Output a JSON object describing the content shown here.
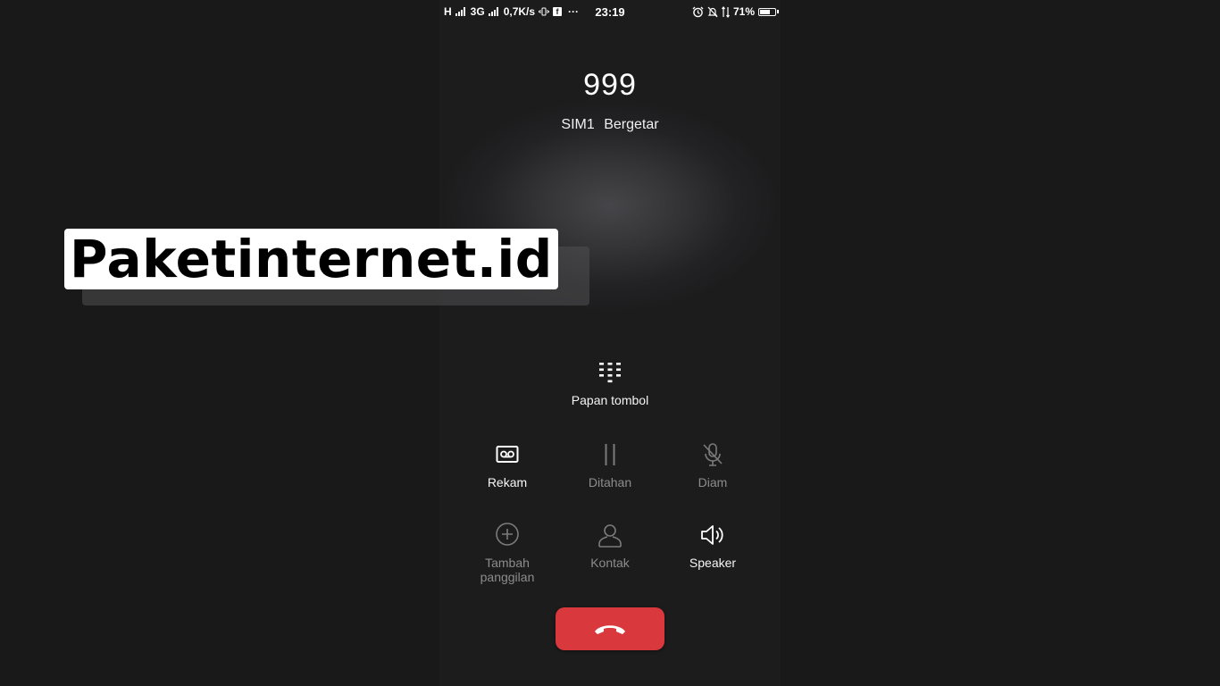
{
  "status_bar": {
    "network_1": "H",
    "network_2": "3G",
    "speed": "0,7K/s",
    "fb_icon_text": "f",
    "more": "···",
    "time": "23:19",
    "battery": "71%",
    "battery_level": 0.71
  },
  "call": {
    "number": "999",
    "sim": "SIM1",
    "mode": "Bergetar"
  },
  "keypad": {
    "label": "Papan tombol"
  },
  "actions": [
    {
      "label": "Rekam",
      "icon": "record-icon",
      "enabled": true
    },
    {
      "label": "Ditahan",
      "icon": "pause-icon",
      "enabled": false
    },
    {
      "label": "Diam",
      "icon": "mic-off-icon",
      "enabled": false
    },
    {
      "label": "Tambah panggilan",
      "label_line1": "Tambah",
      "label_line2": "panggilan",
      "icon": "add-call-icon",
      "enabled": false
    },
    {
      "label": "Kontak",
      "icon": "contact-icon",
      "enabled": false
    },
    {
      "label": "Speaker",
      "icon": "speaker-icon",
      "enabled": true
    }
  ],
  "end_call": {
    "icon": "hang-up-icon",
    "color": "#d9383d"
  },
  "watermark": {
    "text": "Paketinternet.id"
  },
  "colors": {
    "background": "#191919",
    "active_text": "#f6f6f6",
    "dim_text": "#8c8c8c",
    "end_call": "#d9383d"
  }
}
